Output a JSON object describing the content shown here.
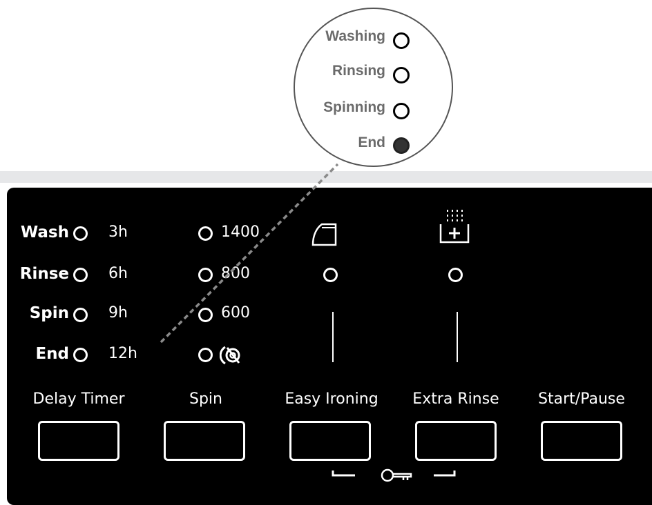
{
  "magnifier": {
    "items": [
      {
        "label": "Washing",
        "on": false
      },
      {
        "label": "Rinsing",
        "on": false
      },
      {
        "label": "Spinning",
        "on": false
      },
      {
        "label": "End",
        "on": true
      }
    ]
  },
  "status_leds": [
    "Wash",
    "Rinse",
    "Spin",
    "End"
  ],
  "delay_values": [
    "3h",
    "6h",
    "9h",
    "12h"
  ],
  "spin_values": [
    "1400",
    "800",
    "600"
  ],
  "no_spin_icon": "no-spin-icon",
  "buttons": [
    "Delay Timer",
    "Spin",
    "Easy Ironing",
    "Extra Rinse",
    "Start/Pause"
  ],
  "icons": {
    "iron": "iron-icon",
    "extra_rinse": "extra-rinse-icon",
    "child_lock": "key-icon"
  }
}
